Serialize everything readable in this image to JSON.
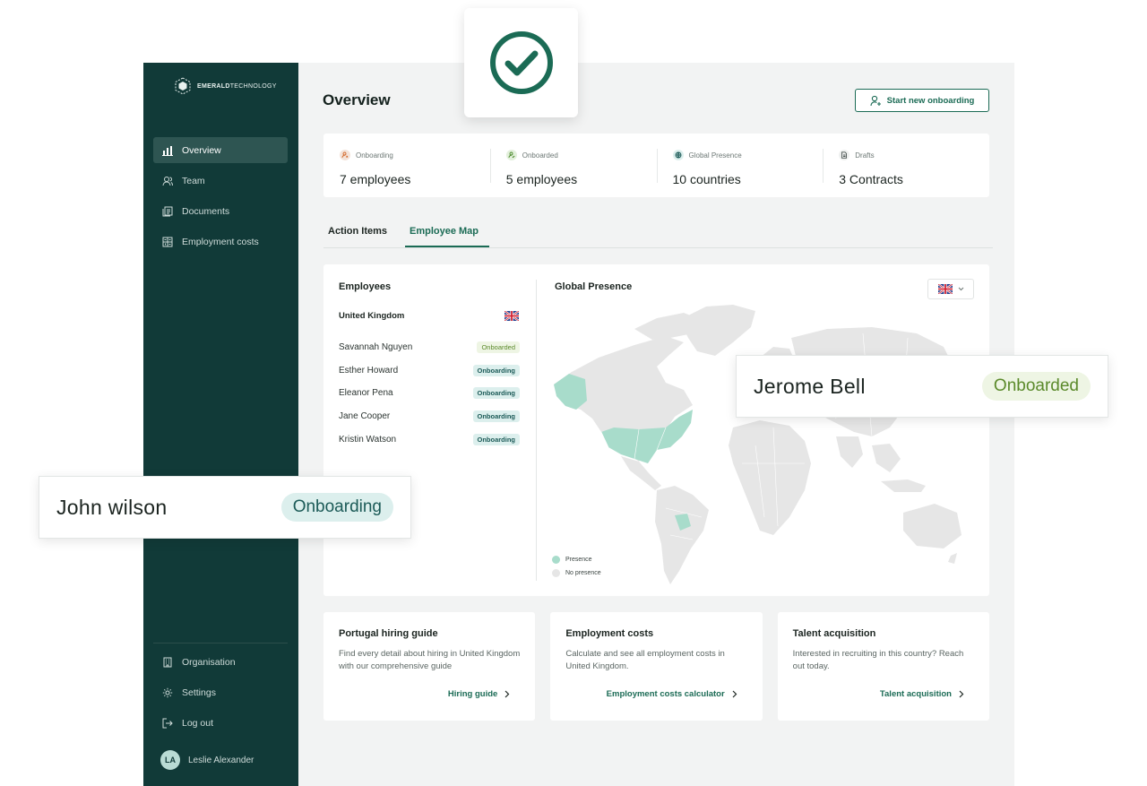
{
  "brand": {
    "name_bold": "EMERALD",
    "name_light": "TECHNOLOGY"
  },
  "sidebar": {
    "items": [
      {
        "label": "Overview",
        "icon": "bar-chart-icon"
      },
      {
        "label": "Team",
        "icon": "users-icon"
      },
      {
        "label": "Documents",
        "icon": "documents-icon"
      },
      {
        "label": "Employment costs",
        "icon": "calculator-icon"
      }
    ],
    "bottom_items": [
      {
        "label": "Organisation",
        "icon": "building-icon"
      },
      {
        "label": "Settings",
        "icon": "gear-icon"
      },
      {
        "label": "Log out",
        "icon": "logout-icon"
      }
    ],
    "user": {
      "initials": "LA",
      "name": "Leslie Alexander"
    }
  },
  "header": {
    "title": "Overview",
    "start_button": "Start new onboarding"
  },
  "stats": [
    {
      "label": "Onboarding",
      "value": "7 employees",
      "icon": "person-pending-icon",
      "color": "#f3e3d9"
    },
    {
      "label": "Onboarded",
      "value": "5 employees",
      "icon": "person-check-icon",
      "color": "#e3f0dc"
    },
    {
      "label": "Global Presence",
      "value": "10 countries",
      "icon": "globe-icon",
      "color": "#dcefed"
    },
    {
      "label": "Drafts",
      "value": "3 Contracts",
      "icon": "document-icon",
      "color": "#eef0ef"
    }
  ],
  "tabs": {
    "action_items": "Action Items",
    "employee_map": "Employee Map"
  },
  "employees": {
    "title": "Employees",
    "country": "United Kingdom",
    "list": [
      {
        "name": "Savannah Nguyen",
        "status": "Onboarded"
      },
      {
        "name": "Esther Howard",
        "status": "Onboarding"
      },
      {
        "name": "Eleanor Pena",
        "status": "Onboarding"
      },
      {
        "name": "Jane Cooper",
        "status": "Onboarding"
      },
      {
        "name": "Kristin Watson",
        "status": "Onboarding"
      }
    ]
  },
  "global_presence": {
    "title": "Global Presence",
    "legend_presence": "Presence",
    "legend_no_presence": "No presence"
  },
  "cards": [
    {
      "title": "Portugal hiring guide",
      "desc": "Find every detail about hiring in United Kingdom with our comprehensive guide",
      "link": "Hiring guide"
    },
    {
      "title": "Employment costs",
      "desc": "Calculate and see all employment costs in United Kingdom.",
      "link": "Employment costs calculator"
    },
    {
      "title": "Talent acquisition",
      "desc": "Interested in recruiting in this country? Reach out today.",
      "link": "Talent acquisition"
    }
  ],
  "floating": {
    "john": {
      "name": "John wilson",
      "status": "Onboarding"
    },
    "jerome": {
      "name": "Jerome Bell",
      "status": "Onboarded"
    }
  },
  "colors": {
    "accent": "#1b6b55",
    "sidebar": "#113a38",
    "presence": "#a8dccb",
    "no_presence": "#e6e6e6",
    "highlight": "#0d3d38"
  }
}
